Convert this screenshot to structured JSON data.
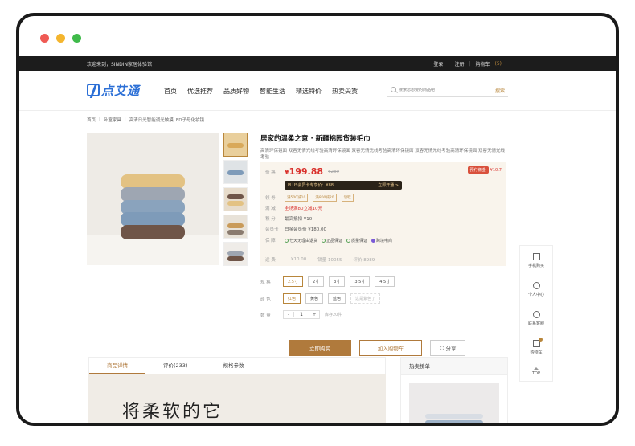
{
  "topbar": {
    "welcome": "欢迎来到，SINDIN家居体验馆",
    "login": "登录",
    "register": "注册",
    "cart_label": "购物车",
    "cart_count": "(5)"
  },
  "header": {
    "logo_text": "点艾通",
    "nav": [
      "首页",
      "优选推荐",
      "品质好物",
      "智能生活",
      "精选特价",
      "热卖尖货"
    ],
    "search_placeholder": "搜索您想要的商品吧",
    "search_button": "搜索"
  },
  "breadcrumb": [
    "首页",
    "卧室家具",
    "高清日光智能调光触摸LED子母化妆镜..."
  ],
  "product": {
    "title": "居家的温柔之意 · 新疆棉园货装毛巾",
    "description": "高清环保镜面 双容无情光线考验高清环保镜面 双容无情光线考验高清环保镜面 双容无情光线考验高清环保镜面 双容无情光线考验",
    "price_label": "价 格",
    "price_symbol": "¥",
    "price": "199.88",
    "original_price": "¥289",
    "presale_badge": "预付佣金",
    "presale_amount": "¥10.7",
    "plus_text": "PLUS会员卡专享价：¥88",
    "plus_link": "立即开通 >",
    "coupon_label": "领 券",
    "coupons": [
      "满500减10",
      "满800减20",
      "领取"
    ],
    "promo_label": "满 减",
    "promo_text": "全场满80立减10元",
    "points_label": "积 分",
    "points_text": "最高抵扣 ¥10",
    "member_label": "会员卡",
    "member_text": "白金会员价 ¥180.00",
    "guarantee_label": "保 障",
    "guarantees": [
      "七天无理由退货",
      "正品保证",
      "质量保证",
      "跨境电商"
    ],
    "stats": [
      "¥10.00",
      "销量 10055",
      "评价 8989"
    ],
    "stats_label": "运 费"
  },
  "options": {
    "spec_label": "规 格",
    "specs": [
      "2.5寸",
      "2寸",
      "3寸",
      "3.5寸",
      "4.5寸"
    ],
    "color_label": "颜 色",
    "colors": [
      "红色",
      "黄色",
      "蓝色",
      "这是紫色了"
    ],
    "qty_label": "数 量",
    "qty": "1",
    "stock": "库存20件"
  },
  "actions": {
    "buy": "立即购买",
    "cart": "加入购物车",
    "share": "分享"
  },
  "tools": {
    "items": [
      "手机购买",
      "个人中心",
      "联系客服",
      "购物车"
    ],
    "top": "TOP"
  },
  "tabs": {
    "items": [
      "商品详情",
      "评价(233)",
      "规格参数"
    ],
    "banner_text": "将柔软的它"
  },
  "hot": {
    "title": "热卖榜单"
  },
  "colors": {
    "accent": "#b07a3c",
    "price_red": "#d9312c",
    "brand_blue": "#2b6fd6"
  }
}
